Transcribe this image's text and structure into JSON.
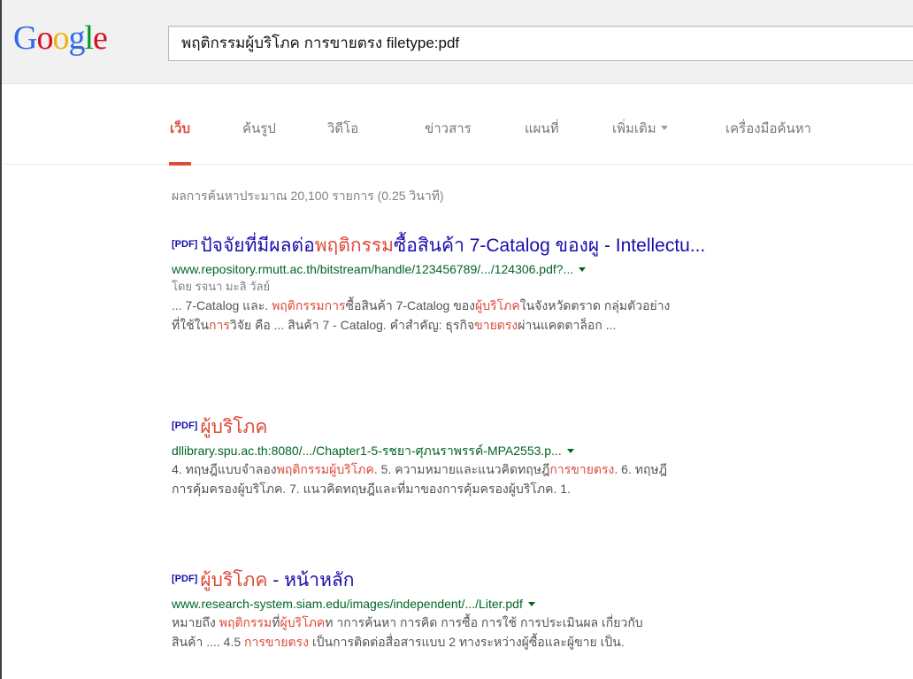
{
  "logo": {
    "letters": [
      "G",
      "o",
      "o",
      "g",
      "l",
      "e"
    ],
    "colors": [
      "#3369e8",
      "#d50f25",
      "#eeb211",
      "#3369e8",
      "#009925",
      "#d50f25"
    ]
  },
  "search": {
    "query": "พฤติกรรมผู้บริโภค การขายตรง filetype:pdf"
  },
  "tabs": [
    {
      "label": "เว็บ",
      "active": true
    },
    {
      "label": "ค้นรูป"
    },
    {
      "label": "วิดีโอ"
    },
    {
      "label": "ข่าวสาร"
    },
    {
      "label": "แผนที่"
    },
    {
      "label": "เพิ่มเติม",
      "dropdown": true
    },
    {
      "label": "เครื่องมือค้นหา"
    }
  ],
  "result_stats": "ผลการค้นหาประมาณ 20,100 รายการ (0.25 วินาที)",
  "results": [
    {
      "badge": "[PDF]",
      "title": [
        {
          "text": "ปัจจัยที่มีผลต่อ"
        },
        {
          "text": "พฤติกรรม",
          "hl": true
        },
        {
          "text": "ซื้อสินค้า 7-Catalog ของผู - Intellectu..."
        }
      ],
      "url": "www.repository.rmutt.ac.th/bitstream/handle/123456789/.../124306.pdf?...",
      "author": "โดย รจนา มะลิ วัลย์",
      "snippet": [
        [
          {
            "text": "... 7-Catalog และ. "
          },
          {
            "text": "พฤติกรรมการ",
            "hl": true
          },
          {
            "text": "ซื้อสินค้า 7-Catalog ของ"
          },
          {
            "text": "ผู้บริโภค",
            "hl": true
          },
          {
            "text": "ในจังหวัดตราด กลุ่มตัวอย่าง"
          }
        ],
        [
          {
            "text": "ที่ใช้ใน"
          },
          {
            "text": "การ",
            "hl": true
          },
          {
            "text": "วิจัย คือ ... สินค้า 7 - Catalog. คำสำคัญ: ธุรกิจ"
          },
          {
            "text": "ขายตรง",
            "hl": true
          },
          {
            "text": "ผ่านแคตตาล็อก ..."
          }
        ]
      ]
    },
    {
      "badge": "[PDF]",
      "title": [
        {
          "text": "ผู้บริโภค",
          "hl": true
        }
      ],
      "url": "dllibrary.spu.ac.th:8080/.../Chapter1-5-รชยา-ศุภนราพรรค์-MPA2553.p...",
      "author": "",
      "snippet": [
        [
          {
            "text": "4. ทฤษฎีแบบจำลอง"
          },
          {
            "text": "พฤติกรรมผู้บริโภค",
            "hl": true
          },
          {
            "text": ". 5. ความหมายและแนวคิดทฤษฎี"
          },
          {
            "text": "การขายตรง",
            "hl": true
          },
          {
            "text": ". 6. ทฤษฎี"
          }
        ],
        [
          {
            "text": "การคุ้มครองผู้บริโภค. 7. แนวคิดทฤษฎีและที่มาของการคุ้มครองผู้บริโภค. 1."
          }
        ]
      ]
    },
    {
      "badge": "[PDF]",
      "title": [
        {
          "text": "ผู้บริโภค",
          "hl": true
        },
        {
          "text": " - หน้าหลัก"
        }
      ],
      "url": "www.research-system.siam.edu/images/independent/.../Liter.pdf",
      "author": "",
      "snippet": [
        [
          {
            "text": "หมายถึง "
          },
          {
            "text": "พฤติกรรม",
            "hl": true
          },
          {
            "text": "ที่"
          },
          {
            "text": "ผู้บริโภค",
            "hl": true
          },
          {
            "text": "ท าการค้นหา การคิด การซื้อ การใช้ การประเมินผล เกี่ยวกับ"
          }
        ],
        [
          {
            "text": "สินค้า .... 4.5 "
          },
          {
            "text": "การขายตรง",
            "hl": true
          },
          {
            "text": " เป็นการติดต่อสื่อสารแบบ 2 ทางระหว่างผู้ซื้อและผู้ขาย เป็น."
          }
        ]
      ]
    }
  ]
}
